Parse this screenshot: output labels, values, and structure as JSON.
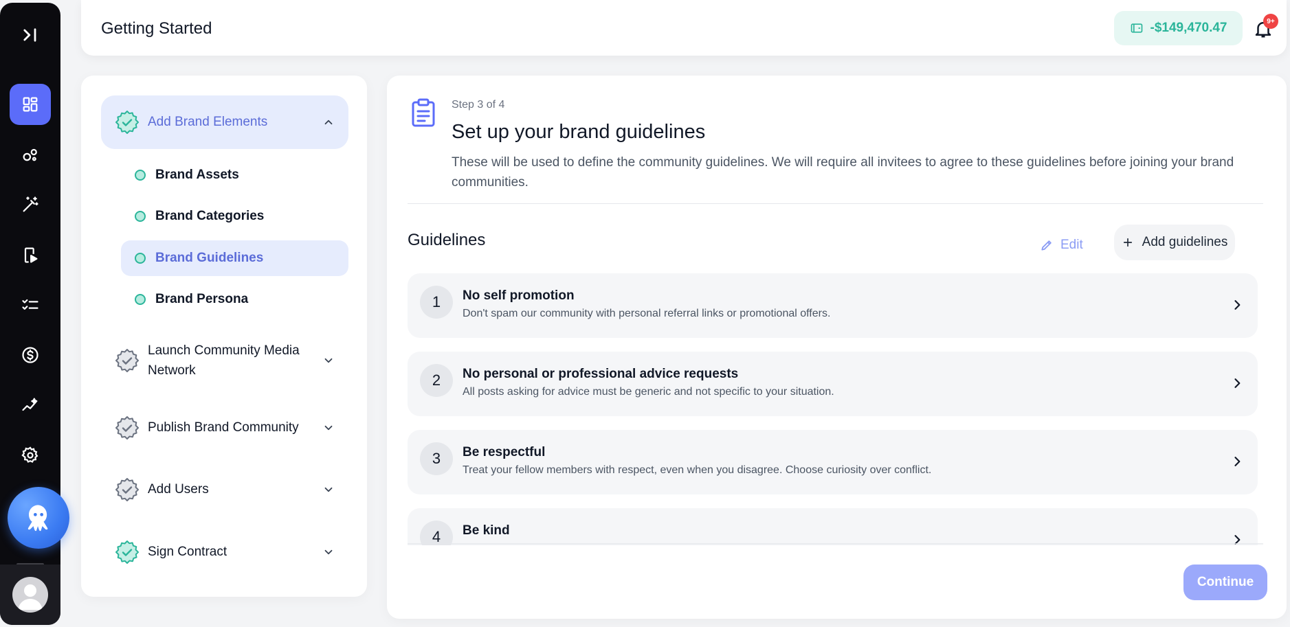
{
  "header": {
    "title": "Getting Started",
    "balance": "-$149,470.47",
    "notif_badge": "9+"
  },
  "rail": {
    "items": [
      {
        "icon": "expand-sidebar-icon"
      },
      {
        "icon": "dashboard-icon",
        "active": true
      },
      {
        "icon": "bubbles-icon"
      },
      {
        "icon": "magic-wand-icon"
      },
      {
        "icon": "media-play-icon"
      },
      {
        "icon": "checklist-icon"
      },
      {
        "icon": "dollar-icon"
      },
      {
        "icon": "analytics-icon"
      },
      {
        "icon": "gear-icon"
      }
    ]
  },
  "steps": {
    "items": [
      {
        "label": "Add Brand Elements",
        "status": "complete",
        "expanded": true
      },
      {
        "label": "Launch Community Media Network",
        "status": "pending",
        "expanded": false
      },
      {
        "label": "Publish Brand Community",
        "status": "pending",
        "expanded": false
      },
      {
        "label": "Add Users",
        "status": "pending",
        "expanded": false
      },
      {
        "label": "Sign Contract",
        "status": "complete",
        "expanded": false
      }
    ],
    "sub_items": [
      {
        "label": "Brand Assets"
      },
      {
        "label": "Brand Categories"
      },
      {
        "label": "Brand Guidelines",
        "active": true
      },
      {
        "label": "Brand Persona"
      }
    ]
  },
  "main": {
    "step_count": "Step 3 of 4",
    "title": "Set up your brand guidelines",
    "description": "These will be used to define the community guidelines. We will require all invitees to agree to these guidelines before joining your brand communities.",
    "section_title": "Guidelines",
    "edit_label": "Edit",
    "add_label": "Add guidelines",
    "continue_label": "Continue",
    "guidelines": [
      {
        "num": "1",
        "title": "No self promotion",
        "desc": "Don't spam our community with personal referral links or promotional offers."
      },
      {
        "num": "2",
        "title": "No personal or professional advice requests",
        "desc": "All posts asking for advice must be generic and not specific to your situation."
      },
      {
        "num": "3",
        "title": "Be respectful",
        "desc": "Treat your fellow members with respect, even when you disagree. Choose curiosity over conflict."
      },
      {
        "num": "4",
        "title": "Be kind",
        "desc": ""
      }
    ]
  },
  "colors": {
    "accent": "#5b6cf9",
    "success": "#2bb59a",
    "rail": "#0b0b0f",
    "active_bg": "#e6ecfd"
  }
}
